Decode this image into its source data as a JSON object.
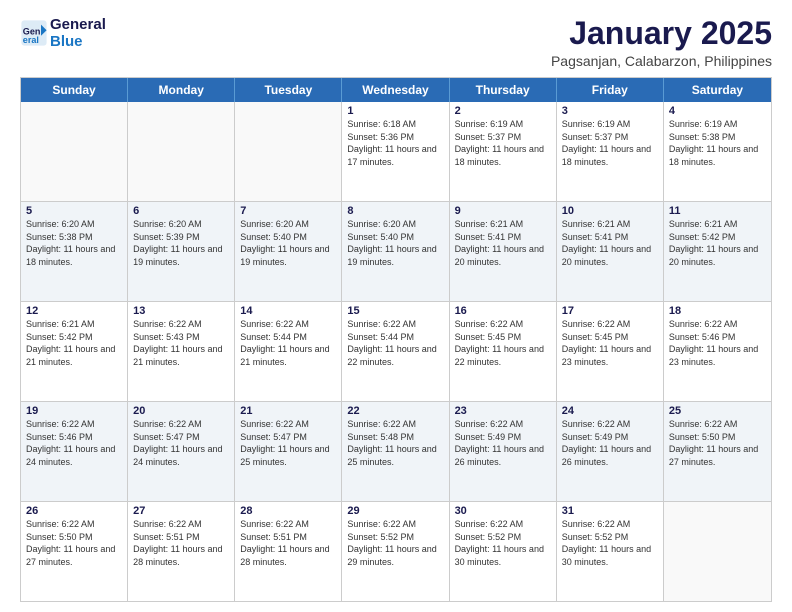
{
  "header": {
    "logo_line1": "General",
    "logo_line2": "Blue",
    "title": "January 2025",
    "subtitle": "Pagsanjan, Calabarzon, Philippines"
  },
  "calendar": {
    "weekdays": [
      "Sunday",
      "Monday",
      "Tuesday",
      "Wednesday",
      "Thursday",
      "Friday",
      "Saturday"
    ],
    "rows": [
      [
        {
          "day": "",
          "sunrise": "",
          "sunset": "",
          "daylight": "",
          "empty": true
        },
        {
          "day": "",
          "sunrise": "",
          "sunset": "",
          "daylight": "",
          "empty": true
        },
        {
          "day": "",
          "sunrise": "",
          "sunset": "",
          "daylight": "",
          "empty": true
        },
        {
          "day": "1",
          "sunrise": "Sunrise: 6:18 AM",
          "sunset": "Sunset: 5:36 PM",
          "daylight": "Daylight: 11 hours and 17 minutes."
        },
        {
          "day": "2",
          "sunrise": "Sunrise: 6:19 AM",
          "sunset": "Sunset: 5:37 PM",
          "daylight": "Daylight: 11 hours and 18 minutes."
        },
        {
          "day": "3",
          "sunrise": "Sunrise: 6:19 AM",
          "sunset": "Sunset: 5:37 PM",
          "daylight": "Daylight: 11 hours and 18 minutes."
        },
        {
          "day": "4",
          "sunrise": "Sunrise: 6:19 AM",
          "sunset": "Sunset: 5:38 PM",
          "daylight": "Daylight: 11 hours and 18 minutes."
        }
      ],
      [
        {
          "day": "5",
          "sunrise": "Sunrise: 6:20 AM",
          "sunset": "Sunset: 5:38 PM",
          "daylight": "Daylight: 11 hours and 18 minutes."
        },
        {
          "day": "6",
          "sunrise": "Sunrise: 6:20 AM",
          "sunset": "Sunset: 5:39 PM",
          "daylight": "Daylight: 11 hours and 19 minutes."
        },
        {
          "day": "7",
          "sunrise": "Sunrise: 6:20 AM",
          "sunset": "Sunset: 5:40 PM",
          "daylight": "Daylight: 11 hours and 19 minutes."
        },
        {
          "day": "8",
          "sunrise": "Sunrise: 6:20 AM",
          "sunset": "Sunset: 5:40 PM",
          "daylight": "Daylight: 11 hours and 19 minutes."
        },
        {
          "day": "9",
          "sunrise": "Sunrise: 6:21 AM",
          "sunset": "Sunset: 5:41 PM",
          "daylight": "Daylight: 11 hours and 20 minutes."
        },
        {
          "day": "10",
          "sunrise": "Sunrise: 6:21 AM",
          "sunset": "Sunset: 5:41 PM",
          "daylight": "Daylight: 11 hours and 20 minutes."
        },
        {
          "day": "11",
          "sunrise": "Sunrise: 6:21 AM",
          "sunset": "Sunset: 5:42 PM",
          "daylight": "Daylight: 11 hours and 20 minutes."
        }
      ],
      [
        {
          "day": "12",
          "sunrise": "Sunrise: 6:21 AM",
          "sunset": "Sunset: 5:42 PM",
          "daylight": "Daylight: 11 hours and 21 minutes."
        },
        {
          "day": "13",
          "sunrise": "Sunrise: 6:22 AM",
          "sunset": "Sunset: 5:43 PM",
          "daylight": "Daylight: 11 hours and 21 minutes."
        },
        {
          "day": "14",
          "sunrise": "Sunrise: 6:22 AM",
          "sunset": "Sunset: 5:44 PM",
          "daylight": "Daylight: 11 hours and 21 minutes."
        },
        {
          "day": "15",
          "sunrise": "Sunrise: 6:22 AM",
          "sunset": "Sunset: 5:44 PM",
          "daylight": "Daylight: 11 hours and 22 minutes."
        },
        {
          "day": "16",
          "sunrise": "Sunrise: 6:22 AM",
          "sunset": "Sunset: 5:45 PM",
          "daylight": "Daylight: 11 hours and 22 minutes."
        },
        {
          "day": "17",
          "sunrise": "Sunrise: 6:22 AM",
          "sunset": "Sunset: 5:45 PM",
          "daylight": "Daylight: 11 hours and 23 minutes."
        },
        {
          "day": "18",
          "sunrise": "Sunrise: 6:22 AM",
          "sunset": "Sunset: 5:46 PM",
          "daylight": "Daylight: 11 hours and 23 minutes."
        }
      ],
      [
        {
          "day": "19",
          "sunrise": "Sunrise: 6:22 AM",
          "sunset": "Sunset: 5:46 PM",
          "daylight": "Daylight: 11 hours and 24 minutes."
        },
        {
          "day": "20",
          "sunrise": "Sunrise: 6:22 AM",
          "sunset": "Sunset: 5:47 PM",
          "daylight": "Daylight: 11 hours and 24 minutes."
        },
        {
          "day": "21",
          "sunrise": "Sunrise: 6:22 AM",
          "sunset": "Sunset: 5:47 PM",
          "daylight": "Daylight: 11 hours and 25 minutes."
        },
        {
          "day": "22",
          "sunrise": "Sunrise: 6:22 AM",
          "sunset": "Sunset: 5:48 PM",
          "daylight": "Daylight: 11 hours and 25 minutes."
        },
        {
          "day": "23",
          "sunrise": "Sunrise: 6:22 AM",
          "sunset": "Sunset: 5:49 PM",
          "daylight": "Daylight: 11 hours and 26 minutes."
        },
        {
          "day": "24",
          "sunrise": "Sunrise: 6:22 AM",
          "sunset": "Sunset: 5:49 PM",
          "daylight": "Daylight: 11 hours and 26 minutes."
        },
        {
          "day": "25",
          "sunrise": "Sunrise: 6:22 AM",
          "sunset": "Sunset: 5:50 PM",
          "daylight": "Daylight: 11 hours and 27 minutes."
        }
      ],
      [
        {
          "day": "26",
          "sunrise": "Sunrise: 6:22 AM",
          "sunset": "Sunset: 5:50 PM",
          "daylight": "Daylight: 11 hours and 27 minutes."
        },
        {
          "day": "27",
          "sunrise": "Sunrise: 6:22 AM",
          "sunset": "Sunset: 5:51 PM",
          "daylight": "Daylight: 11 hours and 28 minutes."
        },
        {
          "day": "28",
          "sunrise": "Sunrise: 6:22 AM",
          "sunset": "Sunset: 5:51 PM",
          "daylight": "Daylight: 11 hours and 28 minutes."
        },
        {
          "day": "29",
          "sunrise": "Sunrise: 6:22 AM",
          "sunset": "Sunset: 5:52 PM",
          "daylight": "Daylight: 11 hours and 29 minutes."
        },
        {
          "day": "30",
          "sunrise": "Sunrise: 6:22 AM",
          "sunset": "Sunset: 5:52 PM",
          "daylight": "Daylight: 11 hours and 30 minutes."
        },
        {
          "day": "31",
          "sunrise": "Sunrise: 6:22 AM",
          "sunset": "Sunset: 5:52 PM",
          "daylight": "Daylight: 11 hours and 30 minutes."
        },
        {
          "day": "",
          "sunrise": "",
          "sunset": "",
          "daylight": "",
          "empty": true
        }
      ]
    ]
  }
}
